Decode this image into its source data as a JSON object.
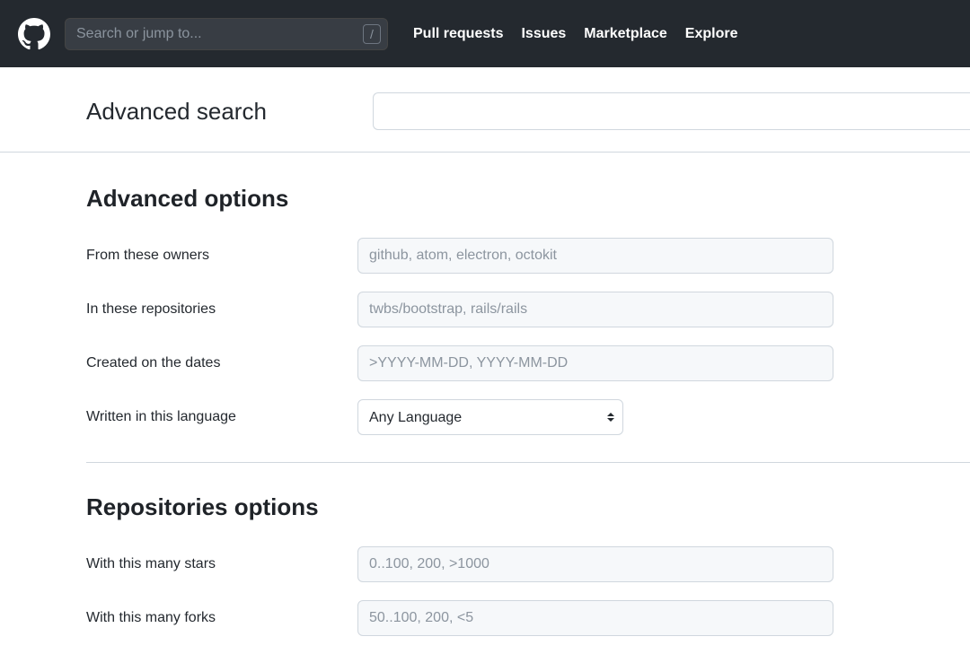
{
  "header": {
    "search_placeholder": "Search or jump to...",
    "search_slash": "/",
    "nav": {
      "pull_requests": "Pull requests",
      "issues": "Issues",
      "marketplace": "Marketplace",
      "explore": "Explore"
    }
  },
  "page": {
    "title": "Advanced search"
  },
  "advanced_options": {
    "title": "Advanced options",
    "owners": {
      "label": "From these owners",
      "placeholder": "github, atom, electron, octokit"
    },
    "repositories": {
      "label": "In these repositories",
      "placeholder": "twbs/bootstrap, rails/rails"
    },
    "dates": {
      "label": "Created on the dates",
      "placeholder": ">YYYY-MM-DD, YYYY-MM-DD"
    },
    "language": {
      "label": "Written in this language",
      "selected": "Any Language"
    }
  },
  "repositories_options": {
    "title": "Repositories options",
    "stars": {
      "label": "With this many stars",
      "placeholder": "0..100, 200, >1000"
    },
    "forks": {
      "label": "With this many forks",
      "placeholder": "50..100, 200, <5"
    }
  }
}
